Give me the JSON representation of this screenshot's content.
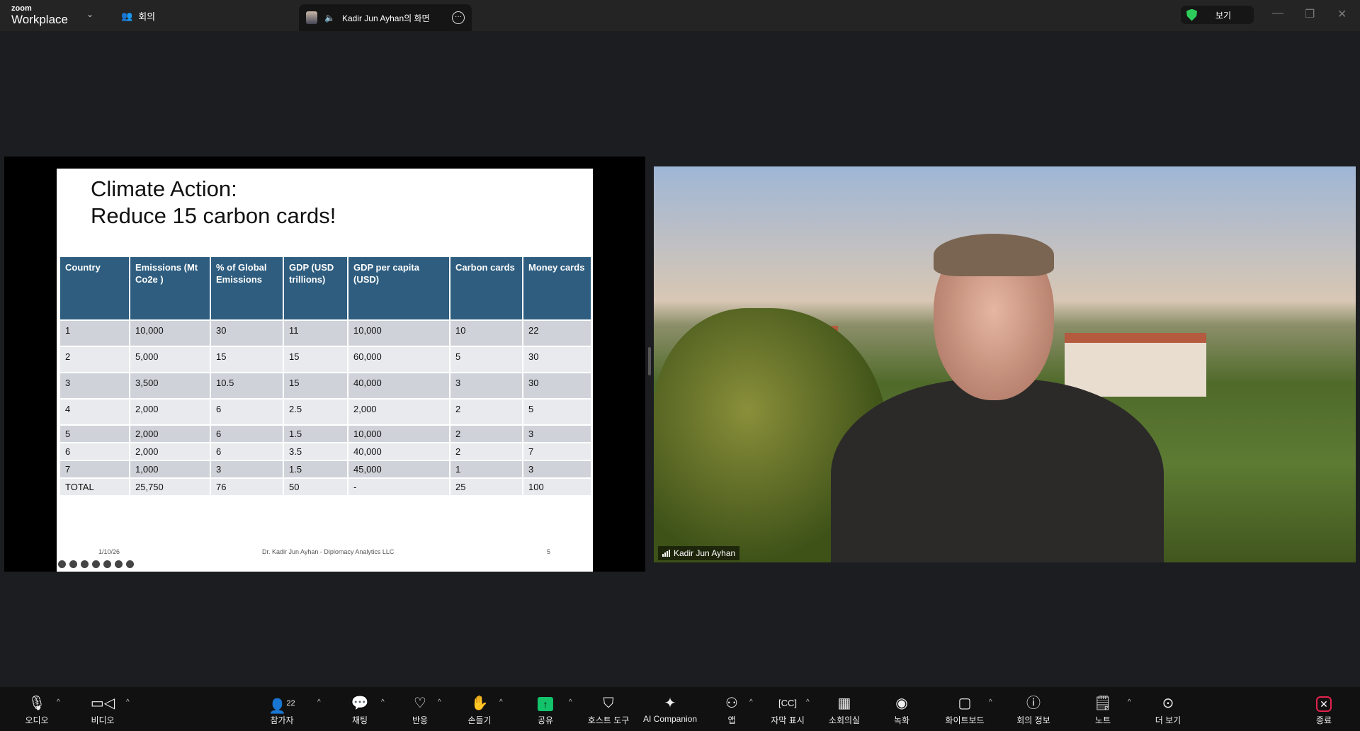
{
  "app": {
    "logo_small": "zoom",
    "logo_big": "Workplace",
    "meeting_label": "회의",
    "share_tab_label": "Kadir Jun Ayhan의 화면",
    "view_label": "보기"
  },
  "slide": {
    "title_line1": "Climate Action:",
    "title_line2": "Reduce 15 carbon cards!",
    "headers": [
      "Country",
      "Emissions (Mt Co2e )",
      "% of Global Emissions",
      "GDP (USD trillions)",
      "GDP per capita (USD)",
      "Carbon cards",
      "Money cards"
    ],
    "rows": [
      [
        "1",
        "10,000",
        "30",
        "11",
        "10,000",
        "10",
        "22"
      ],
      [
        "2",
        "5,000",
        "15",
        "15",
        "60,000",
        "5",
        "30"
      ],
      [
        "3",
        "3,500",
        "10.5",
        "15",
        "40,000",
        "3",
        "30"
      ],
      [
        "4",
        "2,000",
        "6",
        "2.5",
        "2,000",
        "2",
        "5"
      ],
      [
        "5",
        "2,000",
        "6",
        "1.5",
        "10,000",
        "2",
        "3"
      ],
      [
        "6",
        "2,000",
        "6",
        "3.5",
        "40,000",
        "2",
        "7"
      ],
      [
        "7",
        "1,000",
        "3",
        "1.5",
        "45,000",
        "1",
        "3"
      ],
      [
        "TOTAL",
        "25,750",
        "76",
        "50",
        "-",
        "25",
        "100"
      ]
    ],
    "footer_date": "1/10/26",
    "footer_author": "Dr. Kadir Jun Ayhan - Diplomacy Analytics LLC",
    "footer_page": "5"
  },
  "video": {
    "participant_name": "Kadir Jun Ayhan"
  },
  "toolbar": {
    "audio": "오디오",
    "video": "비디오",
    "participants": "참가자",
    "participant_count": "22",
    "chat": "채팅",
    "reactions": "반응",
    "raise_hand": "손들기",
    "share": "공유",
    "host_tools": "호스트 도구",
    "ai_companion": "AI Companion",
    "apps": "앱",
    "captions": "자막 표시",
    "breakout": "소회의실",
    "record": "녹화",
    "whiteboard": "화이트보드",
    "meeting_info": "회의 정보",
    "notes": "노트",
    "more": "더 보기",
    "end": "종료"
  },
  "colors": {
    "table_header": "#2e5d7f",
    "share_green": "#12c36b",
    "end_red": "#e5234c",
    "secure_green": "#2ecc5a"
  }
}
